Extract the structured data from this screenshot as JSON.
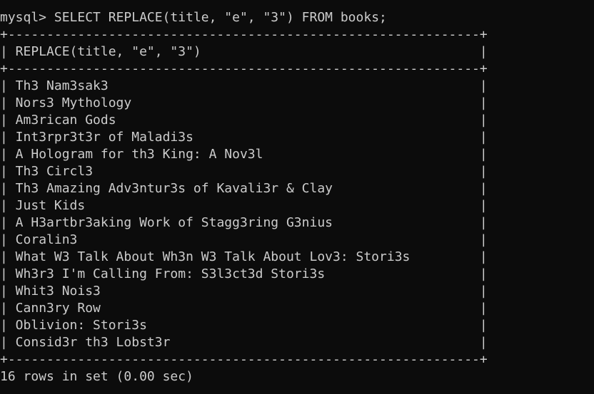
{
  "terminal": {
    "prompt": "mysql>",
    "command": "SELECT REPLACE(title, \"e\", \"3\") FROM books;",
    "border": "+-------------------------------------------------------------+",
    "column_header": "REPLACE(title, \"e\", \"3\")",
    "rows": [
      "Th3 Nam3sak3",
      "Nors3 Mythology",
      "Am3rican Gods",
      "Int3rpr3t3r of Maladi3s",
      "A Hologram for th3 King: A Nov3l",
      "Th3 Circl3",
      "Th3 Amazing Adv3ntur3s of Kavali3r & Clay",
      "Just Kids",
      "A H3artbr3aking Work of Stagg3ring G3nius",
      "Coralin3",
      "What W3 Talk About Wh3n W3 Talk About Lov3: Stori3s",
      "Wh3r3 I'm Calling From: S3l3ct3d Stori3s",
      "Whit3 Nois3",
      "Cann3ry Row",
      "Oblivion: Stori3s",
      "Consid3r th3 Lobst3r"
    ],
    "footer": "16 rows in set (0.00 sec)"
  },
  "colors": {
    "background": "#0c0c0c",
    "text": "#cccccc"
  }
}
